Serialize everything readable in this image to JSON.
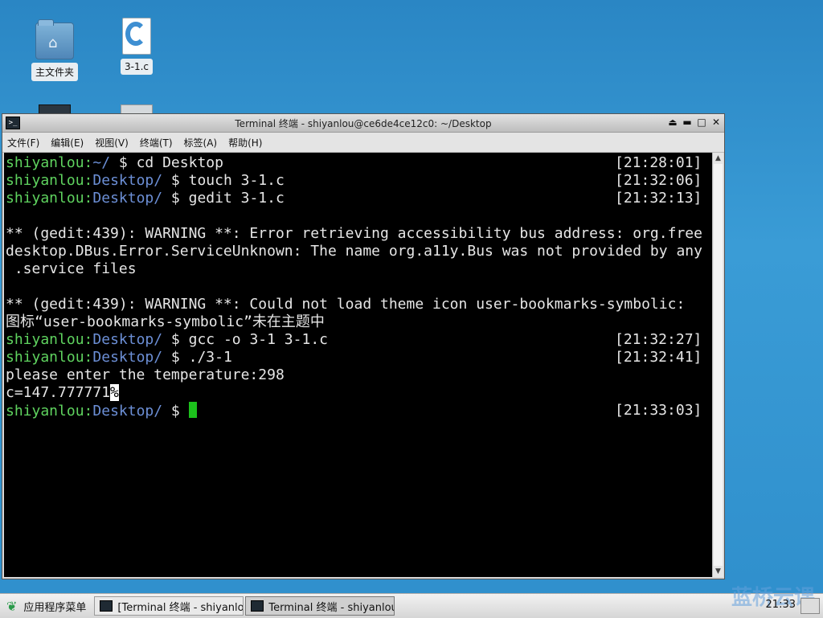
{
  "desktop": {
    "icons": [
      {
        "label": "主文件夹"
      },
      {
        "label": "3-1.c"
      }
    ]
  },
  "window": {
    "title": "Terminal 终端 - shiyanlou@ce6de4ce12c0: ~/Desktop",
    "menu": [
      "文件(F)",
      "编辑(E)",
      "视图(V)",
      "终端(T)",
      "标签(A)",
      "帮助(H)"
    ]
  },
  "terminal": {
    "lines": [
      {
        "user": "shiyanlou",
        "path": "~/",
        "cmd": " $ cd Desktop",
        "ts": "[21:28:01]"
      },
      {
        "user": "shiyanlou",
        "path": "Desktop/",
        "cmd": " $ touch 3-1.c",
        "ts": "[21:32:06]"
      },
      {
        "user": "shiyanlou",
        "path": "Desktop/",
        "cmd": " $ gedit 3-1.c",
        "ts": "[21:32:13]"
      },
      {
        "text": ""
      },
      {
        "text": "** (gedit:439): WARNING **: Error retrieving accessibility bus address: org.free"
      },
      {
        "text": "desktop.DBus.Error.ServiceUnknown: The name org.a11y.Bus was not provided by any"
      },
      {
        "text": " .service files"
      },
      {
        "text": ""
      },
      {
        "text": "** (gedit:439): WARNING **: Could not load theme icon user-bookmarks-symbolic:"
      },
      {
        "text": "图标“user-bookmarks-symbolic”未在主题中"
      },
      {
        "user": "shiyanlou",
        "path": "Desktop/",
        "cmd": " $ gcc -o 3-1 3-1.c",
        "ts": "[21:32:27]"
      },
      {
        "user": "shiyanlou",
        "path": "Desktop/",
        "cmd": " $ ./3-1",
        "ts": "[21:32:41]"
      },
      {
        "text": "please enter the temperature:298"
      },
      {
        "text": "c=147.777771",
        "hl": "%"
      },
      {
        "user": "shiyanlou",
        "path": "Desktop/",
        "cmd": " $ ",
        "ts": "[21:33:03]",
        "cursor": true
      }
    ]
  },
  "taskbar": {
    "start_label": "应用程序菜单",
    "tasks": [
      {
        "label": "[Terminal 终端 - shiyanlou@…"
      },
      {
        "label": "Terminal 终端 - shiyanlou@…"
      }
    ],
    "clock": "21:33",
    "watermark": "蓝桥云课"
  }
}
